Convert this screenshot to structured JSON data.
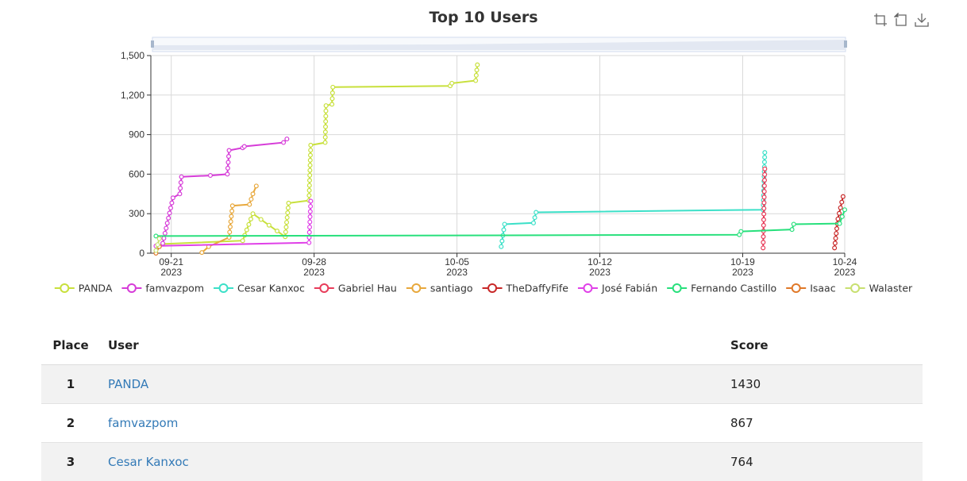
{
  "toolbox": {
    "icons": [
      "zoom-icon",
      "restore-icon",
      "download-icon"
    ]
  },
  "chart_data": {
    "type": "line",
    "title": "Top 10 Users",
    "xaxis": {
      "type": "time",
      "range": [
        "2023-09-20",
        "2023-10-24"
      ],
      "ticks": [
        {
          "date": "2023-09-21",
          "label": "09-21",
          "year": "2023"
        },
        {
          "date": "2023-09-28",
          "label": "09-28",
          "year": "2023"
        },
        {
          "date": "2023-10-05",
          "label": "10-05",
          "year": "2023"
        },
        {
          "date": "2023-10-12",
          "label": "10-12",
          "year": "2023"
        },
        {
          "date": "2023-10-19",
          "label": "10-19",
          "year": "2023"
        },
        {
          "date": "2023-10-24",
          "label": "10-24",
          "year": "2023"
        }
      ]
    },
    "yaxis": {
      "range": [
        0,
        1500
      ],
      "ticks": [
        "0",
        "300",
        "600",
        "900",
        "1,200",
        "1,500"
      ],
      "tick_values": [
        0,
        300,
        600,
        900,
        1200,
        1500
      ]
    },
    "grid": true,
    "legend_position": "bottom",
    "series": [
      {
        "name": "PANDA",
        "color": "#c8e03c",
        "points": [
          [
            "2023-09-20 14:00",
            70
          ],
          [
            "2023-09-24 12:00",
            95
          ],
          [
            "2023-09-25 00:00",
            300
          ],
          [
            "2023-09-26 14:00",
            125
          ],
          [
            "2023-09-26 18:00",
            380
          ],
          [
            "2023-09-27 18:00",
            400
          ],
          [
            "2023-09-27 20:00",
            820
          ],
          [
            "2023-09-28 13:00",
            840
          ],
          [
            "2023-09-28 14:00",
            1120
          ],
          [
            "2023-09-28 21:00",
            1130
          ],
          [
            "2023-09-28 22:00",
            1260
          ],
          [
            "2023-10-04 16:00",
            1270
          ],
          [
            "2023-10-04 18:00",
            1290
          ],
          [
            "2023-10-05 22:00",
            1310
          ],
          [
            "2023-10-06 00:00",
            1430
          ]
        ]
      },
      {
        "name": "famvazpom",
        "color": "#d63cd8",
        "points": [
          [
            "2023-09-20 14:00",
            75
          ],
          [
            "2023-09-21 02:00",
            420
          ],
          [
            "2023-09-21 10:00",
            450
          ],
          [
            "2023-09-21 12:00",
            580
          ],
          [
            "2023-09-22 22:00",
            590
          ],
          [
            "2023-09-23 18:00",
            600
          ],
          [
            "2023-09-23 20:00",
            780
          ],
          [
            "2023-09-24 12:00",
            800
          ],
          [
            "2023-09-24 14:00",
            810
          ],
          [
            "2023-09-26 12:00",
            840
          ],
          [
            "2023-09-26 16:00",
            867
          ]
        ]
      },
      {
        "name": "Cesar Kanxoc",
        "color": "#3ce0c8",
        "points": [
          [
            "2023-10-07 04:00",
            50
          ],
          [
            "2023-10-07 08:00",
            220
          ],
          [
            "2023-10-08 18:00",
            230
          ],
          [
            "2023-10-08 21:00",
            310
          ],
          [
            "2023-10-20 00:00",
            330
          ],
          [
            "2023-10-20 02:00",
            764
          ]
        ]
      },
      {
        "name": "Gabriel Hau",
        "color": "#e83c5a",
        "points": [
          [
            "2023-10-20 00:00",
            40
          ],
          [
            "2023-10-20 02:00",
            640
          ]
        ]
      },
      {
        "name": "santiago",
        "color": "#e8a83c",
        "points": [
          [
            "2023-09-22 12:00",
            5
          ],
          [
            "2023-09-22 20:00",
            50
          ],
          [
            "2023-09-23 20:00",
            120
          ],
          [
            "2023-09-24 00:00",
            360
          ],
          [
            "2023-09-24 20:00",
            370
          ],
          [
            "2023-09-25 00:00",
            450
          ],
          [
            "2023-09-25 04:00",
            510
          ]
        ]
      },
      {
        "name": "TheDaffyFife",
        "color": "#c82828",
        "points": [
          [
            "2023-10-23 12:00",
            40
          ],
          [
            "2023-10-23 16:00",
            260
          ],
          [
            "2023-10-23 22:00",
            430
          ]
        ]
      },
      {
        "name": "José Fabián",
        "color": "#e040e8",
        "points": [
          [
            "2023-09-20 06:00",
            55
          ],
          [
            "2023-09-27 18:00",
            80
          ],
          [
            "2023-09-27 20:00",
            395
          ]
        ]
      },
      {
        "name": "Fernando Castillo",
        "color": "#28e07c",
        "points": [
          [
            "2023-09-20 06:00",
            130
          ],
          [
            "2023-10-18 20:00",
            140
          ],
          [
            "2023-10-18 22:00",
            165
          ],
          [
            "2023-10-21 10:00",
            180
          ],
          [
            "2023-10-21 12:00",
            220
          ],
          [
            "2023-10-23 18:00",
            225
          ],
          [
            "2023-10-24 00:00",
            330
          ]
        ]
      },
      {
        "name": "Isaac",
        "color": "#e07828",
        "points": [
          [
            "2023-09-20 06:00",
            0
          ],
          [
            "2023-09-20 10:00",
            50
          ]
        ]
      },
      {
        "name": "Walaster",
        "color": "#c8e070",
        "points": [
          [
            "2023-09-20 06:00",
            20
          ],
          [
            "2023-09-20 10:00",
            110
          ]
        ]
      }
    ]
  },
  "table": {
    "headers": {
      "place": "Place",
      "user": "User",
      "score": "Score"
    },
    "rows": [
      {
        "place": "1",
        "user": "PANDA",
        "score": "1430"
      },
      {
        "place": "2",
        "user": "famvazpom",
        "score": "867"
      },
      {
        "place": "3",
        "user": "Cesar Kanxoc",
        "score": "764"
      }
    ]
  }
}
